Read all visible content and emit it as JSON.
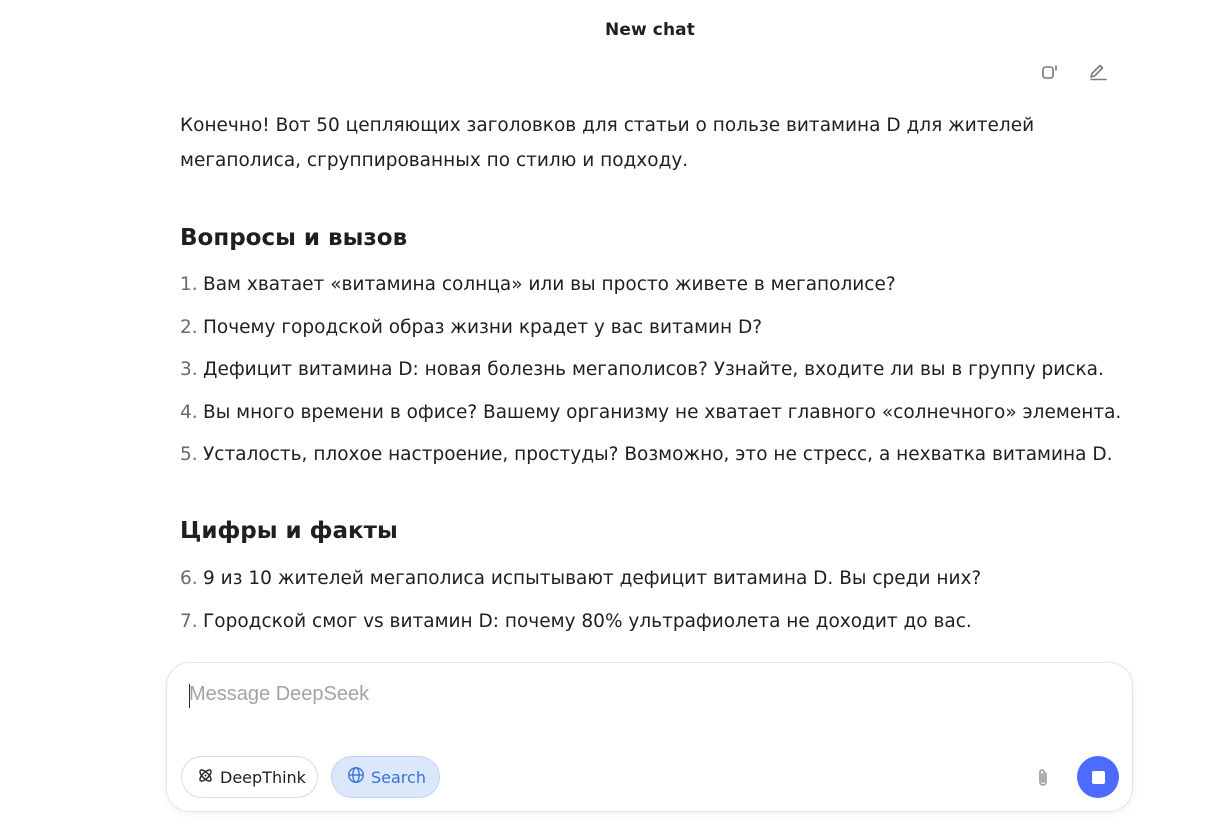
{
  "header": {
    "title": "New chat"
  },
  "message": {
    "intro": "Конечно! Вот 50 цепляющих заголовков для статьи о пользе витамина D для жителей мегаполиса, сгруппированных по стилю и подходу.",
    "sections": [
      {
        "title": "Вопросы и вызов",
        "items": [
          {
            "num": "1.",
            "text": "Вам хватает «витамина солнца» или вы просто живете в мегаполисе?"
          },
          {
            "num": "2.",
            "text": "Почему городской образ жизни крадет у вас витамин D?"
          },
          {
            "num": "3.",
            "text": "Дефицит витамина D: новая болезнь мегаполисов? Узнайте, входите ли вы в группу риска."
          },
          {
            "num": "4.",
            "text": "Вы много времени в офисе? Вашему организму не хватает главного «солнечного» элемента."
          },
          {
            "num": "5.",
            "text": "Усталость, плохое настроение, простуды? Возможно, это не стресс, а нехватка витамина D."
          }
        ]
      },
      {
        "title": "Цифры и факты",
        "items": [
          {
            "num": "6.",
            "text": "9 из 10 жителей мегаполиса испытывают дефицит витамина D. Вы среди них?"
          },
          {
            "num": "7.",
            "text": "Городской смог vs витамин D: почему 80% ультрафиолета не доходит до вас."
          }
        ]
      }
    ]
  },
  "composer": {
    "placeholder": "Message DeepSeek",
    "deepthink_label": "DeepThink",
    "search_label": "Search"
  },
  "colors": {
    "accent": "#4d6bfe",
    "search_chip_bg": "#dbe8fc",
    "search_chip_text": "#3b6fd8"
  },
  "icons": {
    "copy": "copy-icon",
    "edit": "edit-icon",
    "deepthink": "atom-icon",
    "search": "globe-icon",
    "attach": "paperclip-icon",
    "stop": "stop-icon"
  }
}
